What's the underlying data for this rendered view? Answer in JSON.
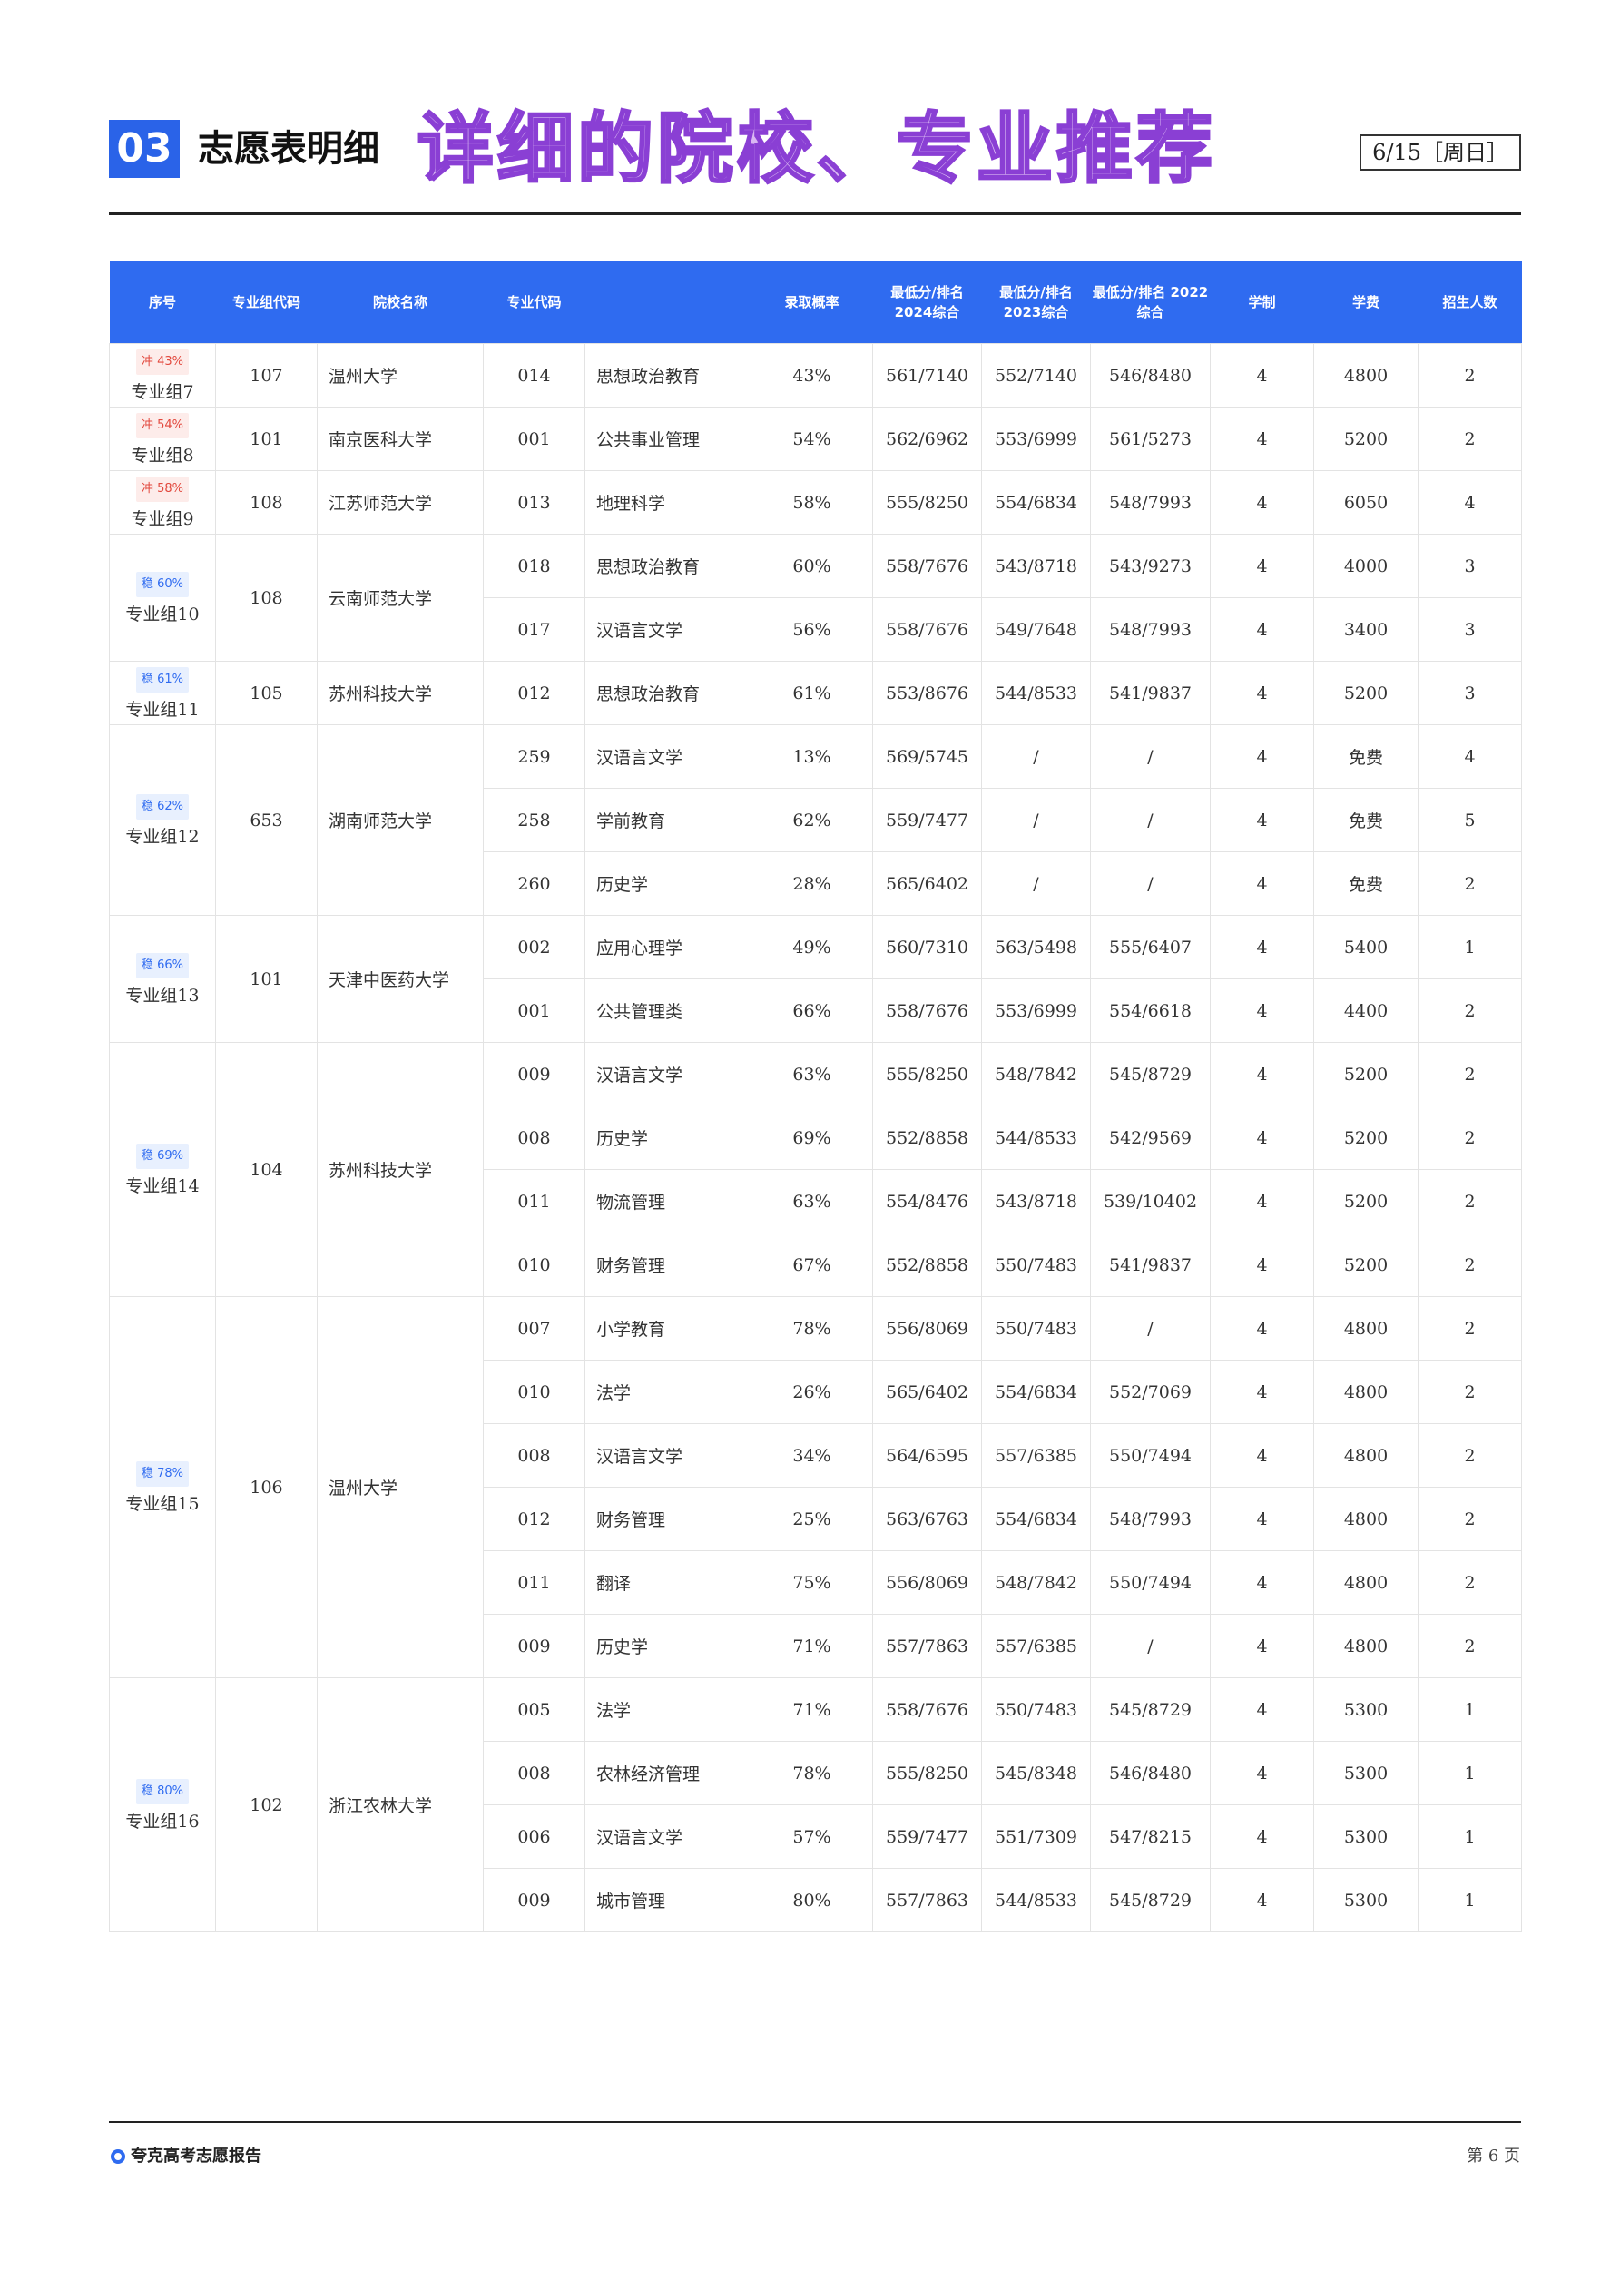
{
  "header": {
    "section_number": "03",
    "title": "志愿表明细",
    "overlay_text": "详细的院校、专业推荐",
    "date": "6/15［周日］"
  },
  "columns": [
    "序号",
    "专业组代码",
    "院校名称",
    "专业代码",
    "",
    "录取概率",
    "最低分/排名 2024综合",
    "最低分/排名 2023综合",
    "最低分/排名 2022综合",
    "学制",
    "学费",
    "招生人数"
  ],
  "groups": [
    {
      "tag_type": "冲",
      "tag": "冲 43%",
      "name": "专业组7",
      "code": "107",
      "school": "温州大学",
      "majors": [
        {
          "code": "014",
          "name": "思想政治教育",
          "prob": "43%",
          "s2024": "561/7140",
          "s2023": "552/7140",
          "s2022": "546/8480",
          "years": "4",
          "fee": "4800",
          "count": "2"
        }
      ]
    },
    {
      "tag_type": "冲",
      "tag": "冲 54%",
      "name": "专业组8",
      "code": "101",
      "school": "南京医科大学",
      "majors": [
        {
          "code": "001",
          "name": "公共事业管理",
          "prob": "54%",
          "s2024": "562/6962",
          "s2023": "553/6999",
          "s2022": "561/5273",
          "years": "4",
          "fee": "5200",
          "count": "2"
        }
      ]
    },
    {
      "tag_type": "冲",
      "tag": "冲 58%",
      "name": "专业组9",
      "code": "108",
      "school": "江苏师范大学",
      "majors": [
        {
          "code": "013",
          "name": "地理科学",
          "prob": "58%",
          "s2024": "555/8250",
          "s2023": "554/6834",
          "s2022": "548/7993",
          "years": "4",
          "fee": "6050",
          "count": "4"
        }
      ]
    },
    {
      "tag_type": "稳",
      "tag": "稳 60%",
      "name": "专业组10",
      "code": "108",
      "school": "云南师范大学",
      "majors": [
        {
          "code": "018",
          "name": "思想政治教育",
          "prob": "60%",
          "s2024": "558/7676",
          "s2023": "543/8718",
          "s2022": "543/9273",
          "years": "4",
          "fee": "4000",
          "count": "3"
        },
        {
          "code": "017",
          "name": "汉语言文学",
          "prob": "56%",
          "s2024": "558/7676",
          "s2023": "549/7648",
          "s2022": "548/7993",
          "years": "4",
          "fee": "3400",
          "count": "3"
        }
      ]
    },
    {
      "tag_type": "稳",
      "tag": "稳 61%",
      "name": "专业组11",
      "code": "105",
      "school": "苏州科技大学",
      "majors": [
        {
          "code": "012",
          "name": "思想政治教育",
          "prob": "61%",
          "s2024": "553/8676",
          "s2023": "544/8533",
          "s2022": "541/9837",
          "years": "4",
          "fee": "5200",
          "count": "3"
        }
      ]
    },
    {
      "tag_type": "稳",
      "tag": "稳 62%",
      "name": "专业组12",
      "code": "653",
      "school": "湖南师范大学",
      "majors": [
        {
          "code": "259",
          "name": "汉语言文学",
          "prob": "13%",
          "s2024": "569/5745",
          "s2023": "/",
          "s2022": "/",
          "years": "4",
          "fee": "免费",
          "count": "4"
        },
        {
          "code": "258",
          "name": "学前教育",
          "prob": "62%",
          "s2024": "559/7477",
          "s2023": "/",
          "s2022": "/",
          "years": "4",
          "fee": "免费",
          "count": "5"
        },
        {
          "code": "260",
          "name": "历史学",
          "prob": "28%",
          "s2024": "565/6402",
          "s2023": "/",
          "s2022": "/",
          "years": "4",
          "fee": "免费",
          "count": "2"
        }
      ]
    },
    {
      "tag_type": "稳",
      "tag": "稳 66%",
      "name": "专业组13",
      "code": "101",
      "school": "天津中医药大学",
      "majors": [
        {
          "code": "002",
          "name": "应用心理学",
          "prob": "49%",
          "s2024": "560/7310",
          "s2023": "563/5498",
          "s2022": "555/6407",
          "years": "4",
          "fee": "5400",
          "count": "1"
        },
        {
          "code": "001",
          "name": "公共管理类",
          "prob": "66%",
          "s2024": "558/7676",
          "s2023": "553/6999",
          "s2022": "554/6618",
          "years": "4",
          "fee": "4400",
          "count": "2"
        }
      ]
    },
    {
      "tag_type": "稳",
      "tag": "稳 69%",
      "name": "专业组14",
      "code": "104",
      "school": "苏州科技大学",
      "majors": [
        {
          "code": "009",
          "name": "汉语言文学",
          "prob": "63%",
          "s2024": "555/8250",
          "s2023": "548/7842",
          "s2022": "545/8729",
          "years": "4",
          "fee": "5200",
          "count": "2"
        },
        {
          "code": "008",
          "name": "历史学",
          "prob": "69%",
          "s2024": "552/8858",
          "s2023": "544/8533",
          "s2022": "542/9569",
          "years": "4",
          "fee": "5200",
          "count": "2"
        },
        {
          "code": "011",
          "name": "物流管理",
          "prob": "63%",
          "s2024": "554/8476",
          "s2023": "543/8718",
          "s2022": "539/10402",
          "years": "4",
          "fee": "5200",
          "count": "2"
        },
        {
          "code": "010",
          "name": "财务管理",
          "prob": "67%",
          "s2024": "552/8858",
          "s2023": "550/7483",
          "s2022": "541/9837",
          "years": "4",
          "fee": "5200",
          "count": "2"
        }
      ]
    },
    {
      "tag_type": "稳",
      "tag": "稳 78%",
      "name": "专业组15",
      "code": "106",
      "school": "温州大学",
      "majors": [
        {
          "code": "007",
          "name": "小学教育",
          "prob": "78%",
          "s2024": "556/8069",
          "s2023": "550/7483",
          "s2022": "/",
          "years": "4",
          "fee": "4800",
          "count": "2"
        },
        {
          "code": "010",
          "name": "法学",
          "prob": "26%",
          "s2024": "565/6402",
          "s2023": "554/6834",
          "s2022": "552/7069",
          "years": "4",
          "fee": "4800",
          "count": "2"
        },
        {
          "code": "008",
          "name": "汉语言文学",
          "prob": "34%",
          "s2024": "564/6595",
          "s2023": "557/6385",
          "s2022": "550/7494",
          "years": "4",
          "fee": "4800",
          "count": "2"
        },
        {
          "code": "012",
          "name": "财务管理",
          "prob": "25%",
          "s2024": "563/6763",
          "s2023": "554/6834",
          "s2022": "548/7993",
          "years": "4",
          "fee": "4800",
          "count": "2"
        },
        {
          "code": "011",
          "name": "翻译",
          "prob": "75%",
          "s2024": "556/8069",
          "s2023": "548/7842",
          "s2022": "550/7494",
          "years": "4",
          "fee": "4800",
          "count": "2"
        },
        {
          "code": "009",
          "name": "历史学",
          "prob": "71%",
          "s2024": "557/7863",
          "s2023": "557/6385",
          "s2022": "/",
          "years": "4",
          "fee": "4800",
          "count": "2"
        }
      ]
    },
    {
      "tag_type": "稳",
      "tag": "稳 80%",
      "name": "专业组16",
      "code": "102",
      "school": "浙江农林大学",
      "majors": [
        {
          "code": "005",
          "name": "法学",
          "prob": "71%",
          "s2024": "558/7676",
          "s2023": "550/7483",
          "s2022": "545/8729",
          "years": "4",
          "fee": "5300",
          "count": "1"
        },
        {
          "code": "008",
          "name": "农林经济管理",
          "prob": "78%",
          "s2024": "555/8250",
          "s2023": "545/8348",
          "s2022": "546/8480",
          "years": "4",
          "fee": "5300",
          "count": "1"
        },
        {
          "code": "006",
          "name": "汉语言文学",
          "prob": "57%",
          "s2024": "559/7477",
          "s2023": "551/7309",
          "s2022": "547/8215",
          "years": "4",
          "fee": "5300",
          "count": "1"
        },
        {
          "code": "009",
          "name": "城市管理",
          "prob": "80%",
          "s2024": "557/7863",
          "s2023": "544/8533",
          "s2022": "545/8729",
          "years": "4",
          "fee": "5300",
          "count": "1"
        }
      ]
    }
  ],
  "footer": {
    "brand": "夸克高考志愿报告",
    "page": "第 6 页"
  },
  "colors": {
    "accent": "#2f6bf0",
    "chong": "#e2483d",
    "overlay_fill": "#d9b8f2",
    "overlay_stroke": "#8a3fd4"
  }
}
